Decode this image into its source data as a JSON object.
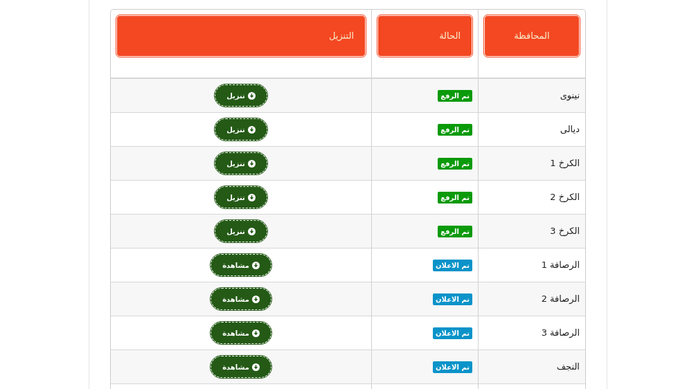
{
  "table": {
    "columns": [
      "المحافظة",
      "الحالة",
      "التنزيل"
    ],
    "rows": [
      {
        "province": "نينوى",
        "status": {
          "kind": "uploaded",
          "label": "تم الرفع"
        },
        "action": "تنزيل"
      },
      {
        "province": "ديالى",
        "status": {
          "kind": "uploaded",
          "label": "تم الرفع"
        },
        "action": "تنزيل"
      },
      {
        "province": "الكرخ 1",
        "status": {
          "kind": "uploaded",
          "label": "تم الرفع"
        },
        "action": "تنزيل"
      },
      {
        "province": "الكرخ 2",
        "status": {
          "kind": "uploaded",
          "label": "تم الرفع"
        },
        "action": "تنزيل"
      },
      {
        "province": "الكرخ 3",
        "status": {
          "kind": "uploaded",
          "label": "تم الرفع"
        },
        "action": "تنزيل"
      },
      {
        "province": "الرصافة 1",
        "status": {
          "kind": "announced",
          "label": "تم الاعلان"
        },
        "action": "مشاهدة"
      },
      {
        "province": "الرصافة 2",
        "status": {
          "kind": "announced",
          "label": "تم الاعلان"
        },
        "action": "مشاهدة"
      },
      {
        "province": "الرصافة 3",
        "status": {
          "kind": "announced",
          "label": "تم الاعلان"
        },
        "action": "مشاهدة"
      },
      {
        "province": "النجف",
        "status": {
          "kind": "announced",
          "label": "تم الاعلان"
        },
        "action": "مشاهدة"
      }
    ]
  }
}
